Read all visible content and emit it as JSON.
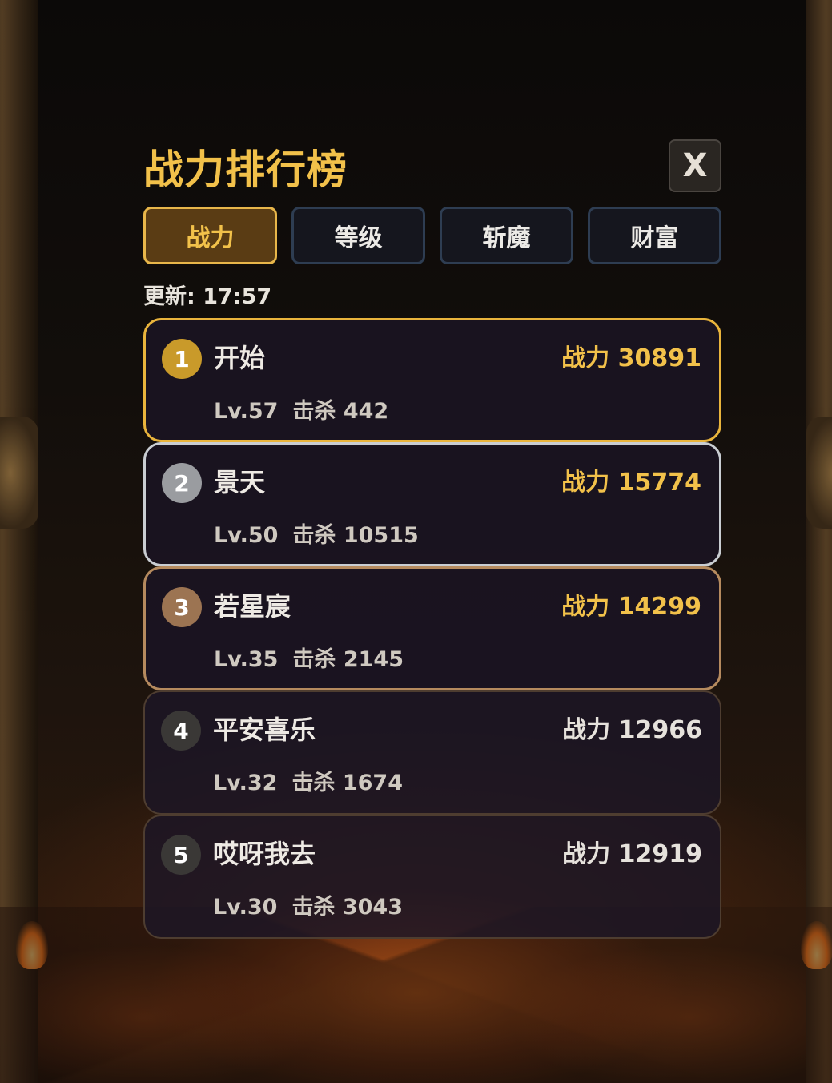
{
  "title": "战力排行榜",
  "close_label": "X",
  "tabs": [
    {
      "label": "战力",
      "active": true
    },
    {
      "label": "等级",
      "active": false
    },
    {
      "label": "斩魔",
      "active": false
    },
    {
      "label": "财富",
      "active": false
    }
  ],
  "updated": "更新: 17:57",
  "colors": {
    "accent": "#f2c14a",
    "rank1": "#c99a2a",
    "rank2": "#9a9ca0",
    "rank3": "#9c7452",
    "rank_other": "#3a3836"
  },
  "rows": [
    {
      "rank": "1",
      "name": "开始",
      "power": "战力 30891",
      "level": "Lv.57",
      "kills": "击杀 442"
    },
    {
      "rank": "2",
      "name": "景天",
      "power": "战力 15774",
      "level": "Lv.50",
      "kills": "击杀 10515"
    },
    {
      "rank": "3",
      "name": "若星宸",
      "power": "战力 14299",
      "level": "Lv.35",
      "kills": "击杀 2145"
    },
    {
      "rank": "4",
      "name": "平安喜乐",
      "power": "战力 12966",
      "level": "Lv.32",
      "kills": "击杀 1674"
    },
    {
      "rank": "5",
      "name": "哎呀我去",
      "power": "战力 12919",
      "level": "Lv.30",
      "kills": "击杀 3043"
    }
  ]
}
